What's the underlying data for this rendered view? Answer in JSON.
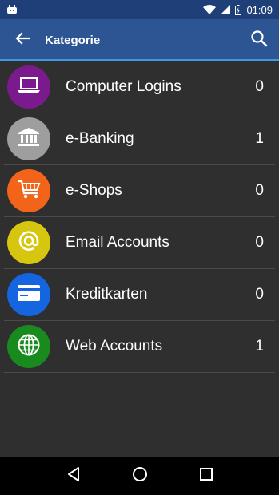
{
  "status_bar": {
    "time": "01:09"
  },
  "app_bar": {
    "title": "Kategorie"
  },
  "categories": [
    {
      "label": "Computer Logins",
      "count": "0",
      "color": "#7b1a8c",
      "icon": "laptop-icon"
    },
    {
      "label": "e-Banking",
      "count": "1",
      "color": "#9e9e9e",
      "icon": "bank-icon"
    },
    {
      "label": "e-Shops",
      "count": "0",
      "color": "#f26419",
      "icon": "shopping-cart-icon"
    },
    {
      "label": "Email Accounts",
      "count": "0",
      "color": "#d7c610",
      "icon": "email-at-icon"
    },
    {
      "label": "Kreditkarten",
      "count": "0",
      "color": "#1565e0",
      "icon": "credit-card-icon"
    },
    {
      "label": "Web Accounts",
      "count": "1",
      "color": "#198a1e",
      "icon": "globe-icon"
    }
  ]
}
